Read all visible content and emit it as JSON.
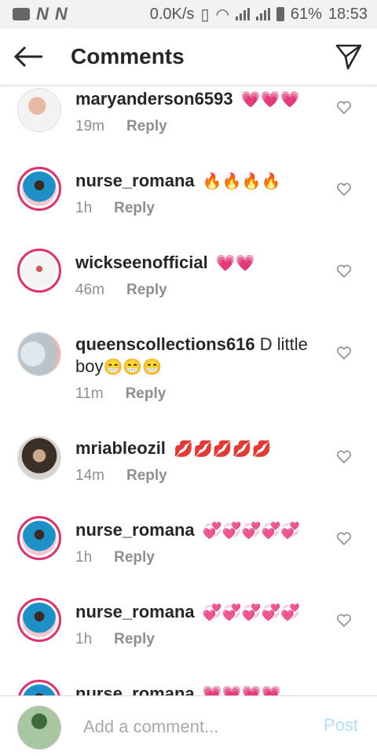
{
  "status_bar": {
    "network_speed": "0.0K/s",
    "battery": "61%",
    "time": "18:53",
    "n_icons": [
      "N",
      "N"
    ]
  },
  "header": {
    "title": "Comments",
    "back_icon": "arrow-left-icon",
    "share_icon": "paper-plane-icon"
  },
  "comments": [
    {
      "username": "maryanderson6593",
      "text": "",
      "emoji": "💗💗💗",
      "time": "19m",
      "reply": "Reply"
    },
    {
      "username": "nurse_romana",
      "text": "",
      "emoji": "🔥🔥🔥🔥",
      "time": "1h",
      "reply": "Reply"
    },
    {
      "username": "wickseenofficial",
      "text": "",
      "emoji": "💗💗",
      "time": "46m",
      "reply": "Reply"
    },
    {
      "username": "queenscollections616",
      "text": "D little boy",
      "emoji": "😁😁😁",
      "time": "11m",
      "reply": "Reply"
    },
    {
      "username": "mriableozil",
      "text": "",
      "emoji": "💋💋💋💋💋",
      "time": "14m",
      "reply": "Reply"
    },
    {
      "username": "nurse_romana",
      "text": "",
      "emoji": "💞💞💞💞💞",
      "time": "1h",
      "reply": "Reply"
    },
    {
      "username": "nurse_romana",
      "text": "",
      "emoji": "💞💞💞💞💞",
      "time": "1h",
      "reply": "Reply"
    },
    {
      "username": "nurse_romana",
      "text": "",
      "emoji": "💗💗💗💗",
      "time": "",
      "reply": ""
    }
  ],
  "composer": {
    "placeholder": "Add a comment...",
    "post_label": "Post"
  },
  "colors": {
    "story_ring": "#e1306c",
    "post_disabled": "#b2dffc",
    "meta_gray": "#8e8e8e"
  }
}
